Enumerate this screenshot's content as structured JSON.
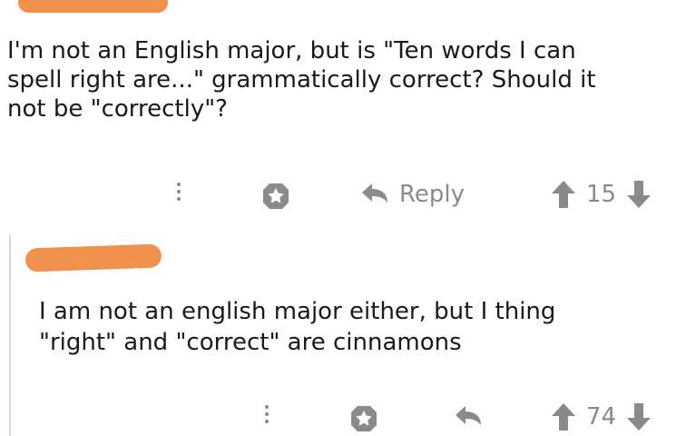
{
  "comments": [
    {
      "text_lines": [
        "I'm not an English major, but is \"Ten words I can",
        "spell right are...\" grammatically correct? Should it",
        "not be \"correctly\"?"
      ],
      "actions": {
        "reply_label": "Reply",
        "score": "15"
      }
    },
    {
      "text_lines": [
        "I am not an english major either, but I thing",
        "\"right\" and \"correct\" are cinnamons"
      ],
      "actions": {
        "reply_label": "",
        "score": "74"
      }
    }
  ],
  "colors": {
    "redaction": "#f0924e",
    "icon_gray": "#8a8a8a",
    "text": "#1a1a1b"
  },
  "icons": [
    "more-options-icon",
    "award-icon",
    "reply-arrow-icon",
    "upvote-icon",
    "downvote-icon"
  ]
}
